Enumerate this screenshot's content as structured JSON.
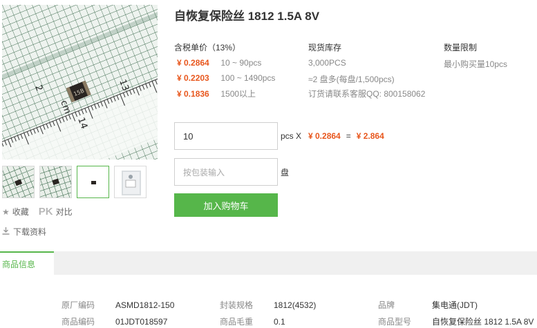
{
  "product": {
    "title": "自恢复保险丝 1812 1.5A 8V",
    "chip_marking": "15B",
    "ruler_labels": [
      "13",
      "14",
      "cm",
      "2"
    ]
  },
  "gallery": {
    "thumbnails": [
      "thumb-1",
      "thumb-2",
      "thumb-3",
      "thumb-4"
    ]
  },
  "side_actions": {
    "favorite": "收藏",
    "pk": "PK",
    "compare": "对比",
    "download": "下载资料"
  },
  "pricing": {
    "header": "含税单价（13%）",
    "tiers": [
      {
        "price": "¥ 0.2864",
        "qty": "10 ~ 90pcs"
      },
      {
        "price": "¥ 0.2203",
        "qty": "100 ~ 1490pcs"
      },
      {
        "price": "¥ 0.1836",
        "qty": "1500以上"
      }
    ]
  },
  "stock": {
    "header": "现货库存",
    "lines": [
      "3,000PCS",
      "≈2 盘多(每盘/1,500pcs)",
      "订货请联系客服QQ: 800158062"
    ]
  },
  "limit": {
    "header": "数量限制",
    "text": "最小购买量10pcs"
  },
  "order": {
    "qty_value": "10",
    "qty_unit": "pcs X",
    "unit_price": "¥ 0.2864",
    "equals": "=",
    "total": "¥ 2.864",
    "pkg_placeholder": "按包装输入",
    "pkg_unit": "盘",
    "add_to_cart": "加入购物车"
  },
  "tabs": {
    "active": "商品信息"
  },
  "specs": {
    "row1": [
      {
        "key": "原厂编码",
        "value": "ASMD1812-150"
      },
      {
        "key": "封装规格",
        "value": "1812(4532)"
      },
      {
        "key": "品牌",
        "value": "集电通(JDT)"
      }
    ],
    "row2": [
      {
        "key": "商品编码",
        "value": "01JDT018597"
      },
      {
        "key": "商品毛重",
        "value": "0.1"
      },
      {
        "key": "商品型号",
        "value": "自恢复保险丝 1812 1.5A 8V"
      }
    ]
  },
  "colors": {
    "accent_green": "#56b64a",
    "price_orange": "#e8561c"
  }
}
